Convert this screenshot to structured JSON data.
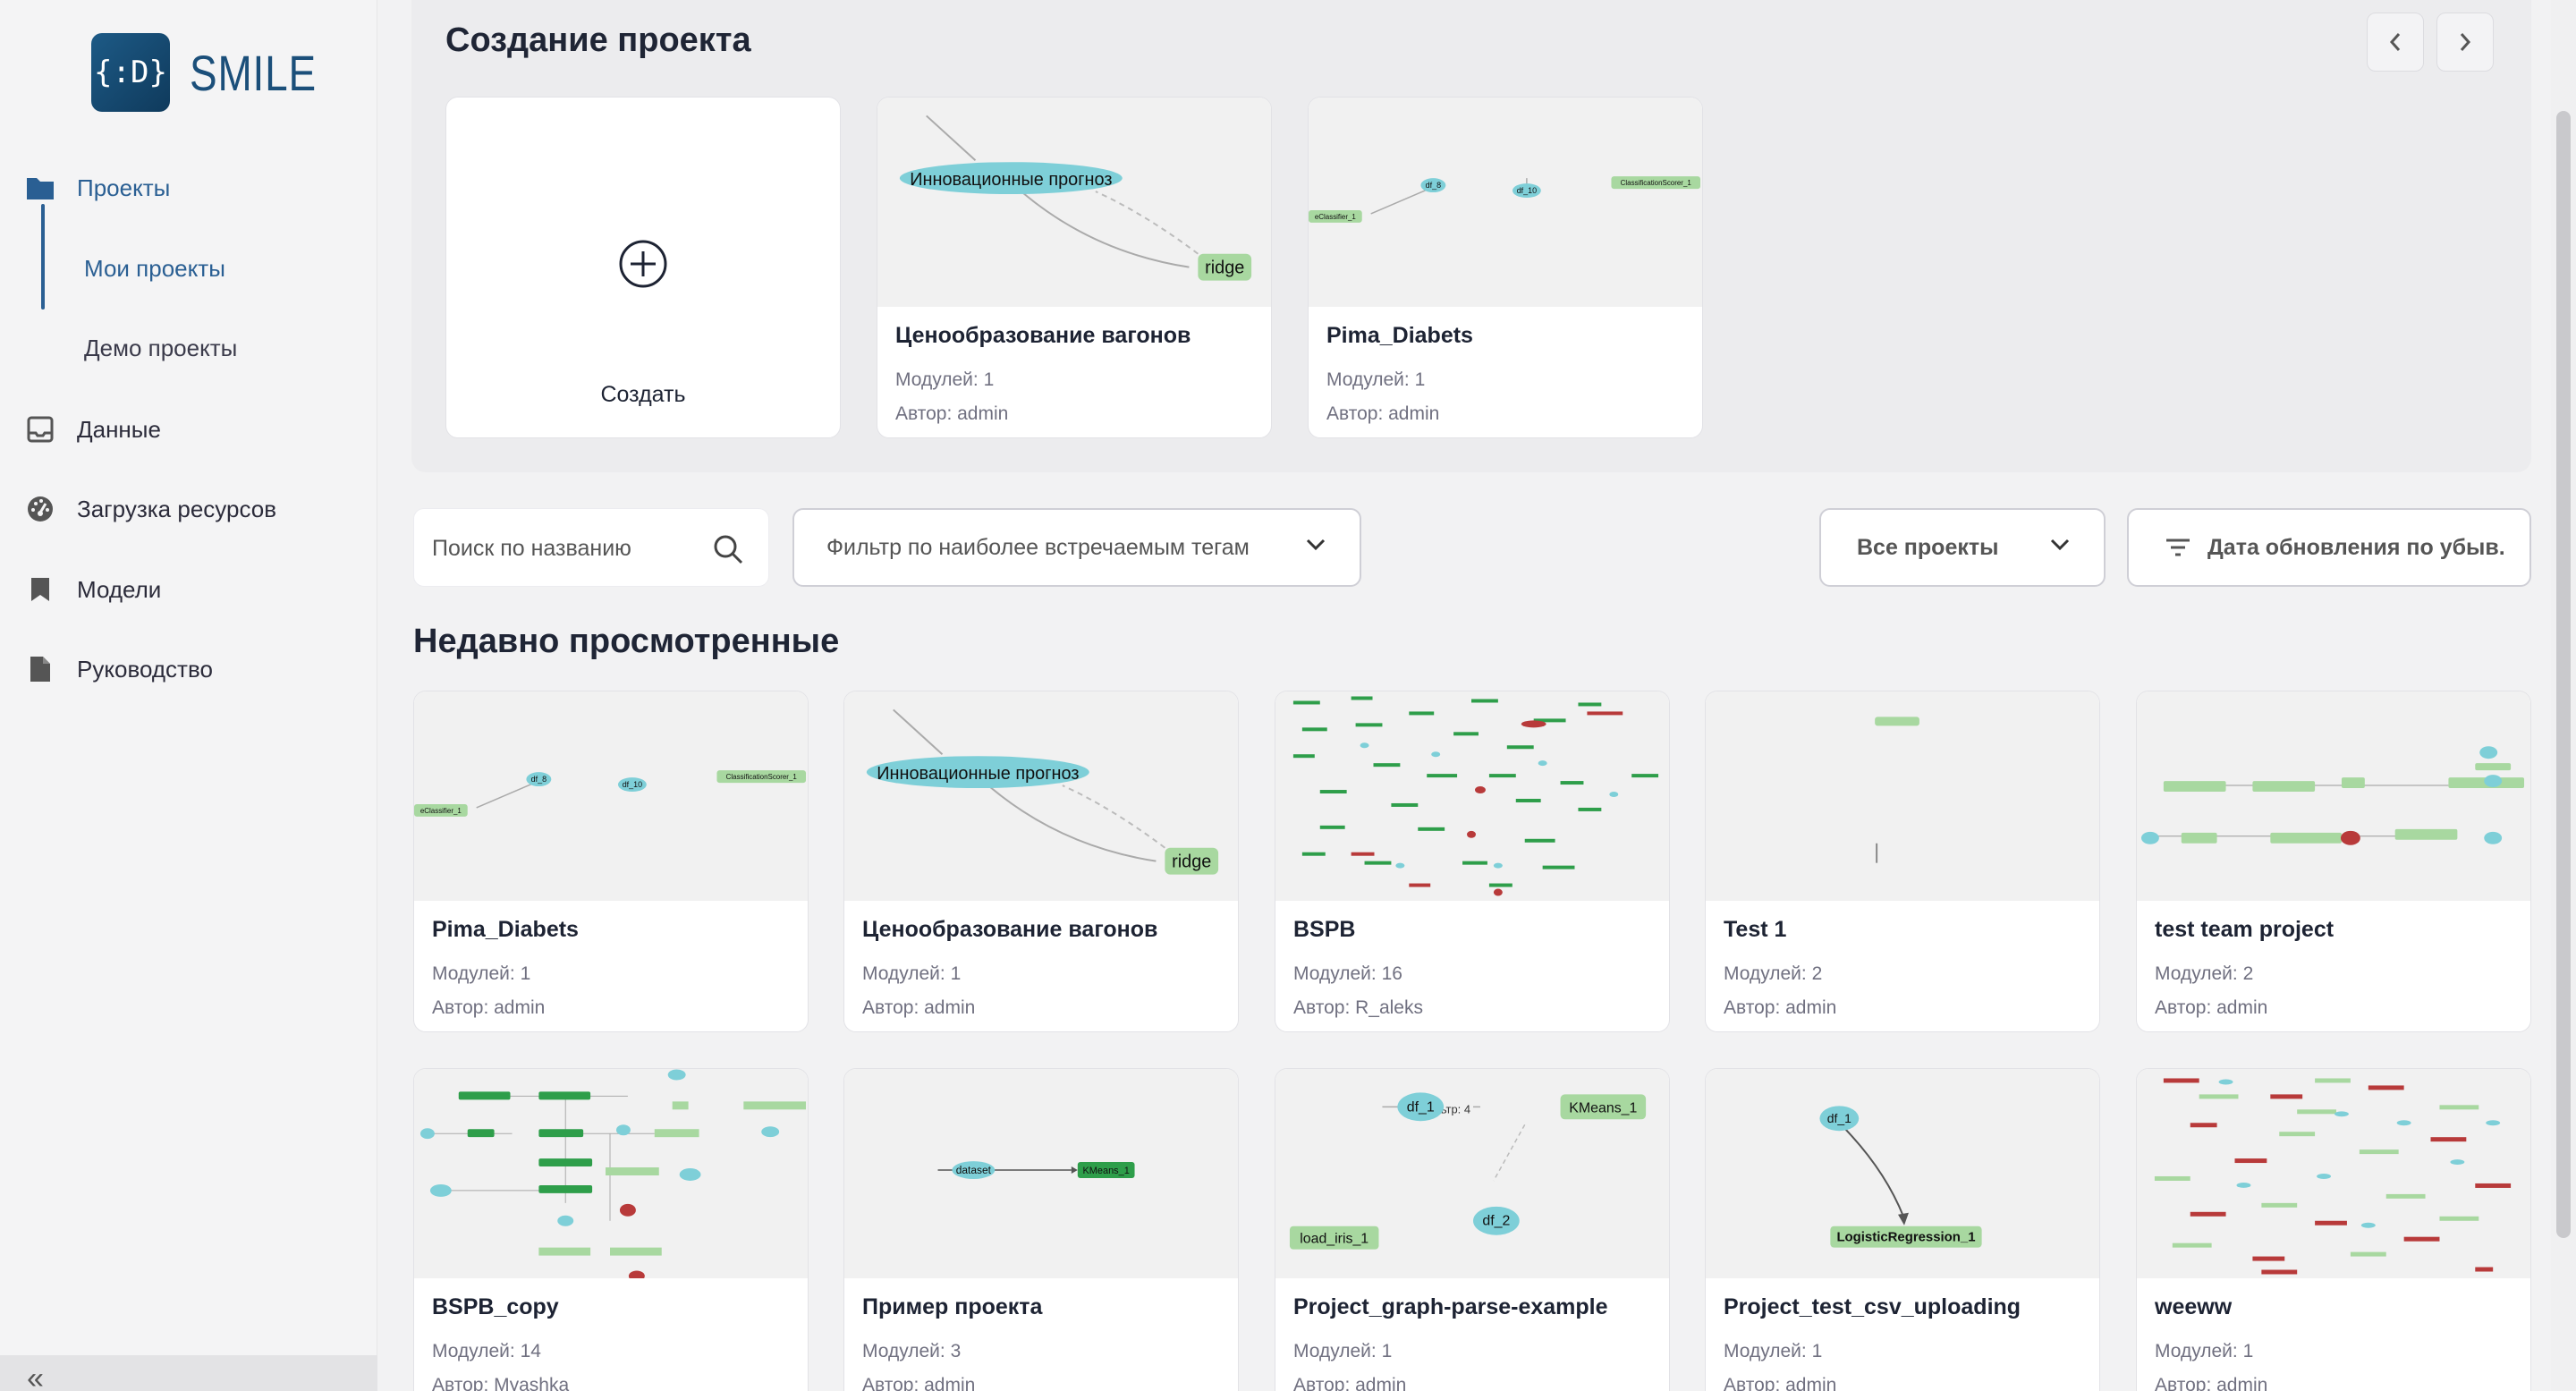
{
  "brand": {
    "mark": "{:D}",
    "name": "SMILE"
  },
  "sidebar": {
    "items": [
      {
        "label": "Проекты"
      },
      {
        "label": "Данные"
      },
      {
        "label": "Загрузка ресурсов"
      },
      {
        "label": "Модели"
      },
      {
        "label": "Руководство"
      }
    ],
    "subitems": [
      {
        "label": "Мои проекты"
      },
      {
        "label": "Демо проекты"
      }
    ],
    "collapse_glyph": "«"
  },
  "create_section": {
    "title": "Создание проекта",
    "create_label": "Создать",
    "cards": [
      {
        "title": "Ценообразование вагонов",
        "modules": "Модулей: 1",
        "author": "Автор: admin"
      },
      {
        "title": "Pima_Diabets",
        "modules": "Модулей: 1",
        "author": "Автор: admin"
      }
    ]
  },
  "filters": {
    "search_placeholder": "Поиск по названию",
    "tags_placeholder": "Фильтр по наиболее встречаемым тегам",
    "projects_filter": "Все проекты",
    "sort": "Дата обновления по убыв."
  },
  "recent": {
    "title": "Недавно просмотренные",
    "cards": [
      {
        "title": "Pima_Diabets",
        "modules": "Модулей: 1",
        "author": "Автор: admin"
      },
      {
        "title": "Ценообразование вагонов",
        "modules": "Модулей: 1",
        "author": "Автор: admin"
      },
      {
        "title": "BSPB",
        "modules": "Модулей: 16",
        "author": "Автор: R_aleks"
      },
      {
        "title": "Test 1",
        "modules": "Модулей: 2",
        "author": "Автор: admin"
      },
      {
        "title": "test team project",
        "modules": "Модулей: 2",
        "author": "Автор: admin"
      },
      {
        "title": "BSPB_copy",
        "modules": "Модулей: 14",
        "author": "Автор: Myashka"
      },
      {
        "title": "Пример проекта",
        "modules": "Модулей: 3",
        "author": "Автор: admin"
      },
      {
        "title": "Project_graph-parse-example",
        "modules": "Модулей: 1",
        "author": "Автор: admin"
      },
      {
        "title": "Project_test_csv_uploading",
        "modules": "Модулей: 1",
        "author": "Автор: admin"
      },
      {
        "title": "weeww",
        "modules": "Модулей: 1",
        "author": "Автор: admin"
      }
    ]
  },
  "graph_labels": {
    "innov": "Инновационные прогноз",
    "ridge": "ridge",
    "df8": "df_8",
    "df10": "df_10",
    "scorer": "ClassificationScorer_1",
    "classifier": "eClassifier_1",
    "df1": "df_1",
    "df2": "df_2",
    "kmeans": "KMeans_1",
    "filter4": "Фильтр: 4",
    "loadiris": "load_iris_1",
    "dataset": "dataset",
    "logreg": "LogisticRegression_1"
  },
  "colors": {
    "accent": "#2a5f93",
    "node_blue": "#7ecfd8",
    "node_green": "#a8d8a0",
    "node_dark_green": "#2e9e4a",
    "node_red": "#b83a3a"
  }
}
